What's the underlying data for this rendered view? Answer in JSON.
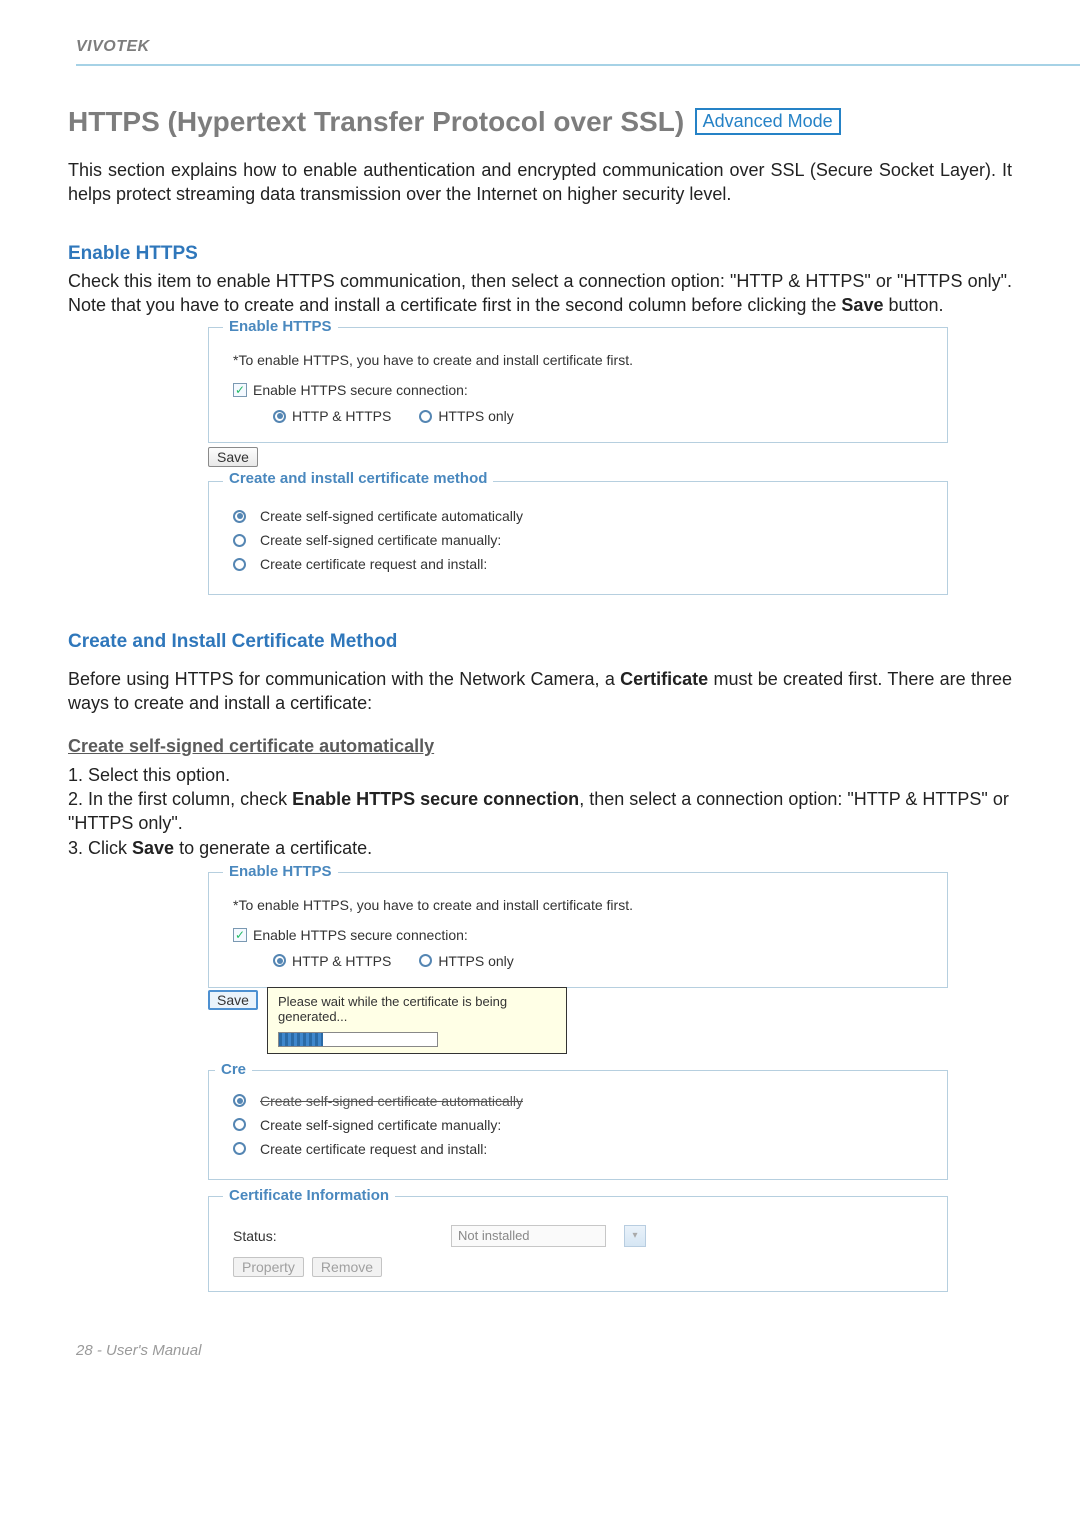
{
  "header": {
    "brand": "VIVOTEK"
  },
  "title": {
    "main": "HTTPS (Hypertext Transfer Protocol over SSL)",
    "badge": "Advanced Mode"
  },
  "intro": "This section explains how to enable authentication and encrypted communication over SSL (Secure Socket Layer). It helps protect streaming data transmission over the Internet on higher security level.",
  "sections": {
    "enable": {
      "heading": "Enable HTTPS",
      "body_1": "Check this item to enable HTTPS communication, then select a connection option: \"HTTP & HTTPS\" or \"HTTPS only\". Note that you have to create and install a certificate first in the second column before clicking the ",
      "body_bold": "Save",
      "body_2": " button."
    },
    "cert": {
      "heading": "Create and Install Certificate Method",
      "body_1": "Before using HTTPS for communication with the Network Camera, a ",
      "body_bold": "Certificate",
      "body_2": " must be created first. There are three ways to create and install a certificate:"
    },
    "auto": {
      "subheading": "Create self-signed certificate automatically",
      "step1": "Select this option.",
      "step2_a": "In the first column, check ",
      "step2_bold": "Enable HTTPS secure connection",
      "step2_b": ", then select a connection option: \"HTTP & HTTPS\" or \"HTTPS only\".",
      "step3_a": "Click ",
      "step3_bold": "Save",
      "step3_b": " to generate a certificate."
    }
  },
  "panel1": {
    "legend": "Enable HTTPS",
    "hint": "*To enable HTTPS, you have to create and install certificate first.",
    "chk_label": "Enable HTTPS secure connection:",
    "chk_checked": true,
    "radio1": "HTTP & HTTPS",
    "radio2": "HTTPS only",
    "radio_selected": 1,
    "save": "Save",
    "cert_legend": "Create and install certificate method",
    "opts": {
      "a": "Create self-signed certificate automatically",
      "b": "Create self-signed certificate manually:",
      "c": "Create certificate request and install:"
    },
    "cert_selected": 0
  },
  "panel2": {
    "legend": "Enable HTTPS",
    "hint": "*To enable HTTPS, you have to create and install certificate first.",
    "chk_label": "Enable HTTPS secure connection:",
    "radio1": "HTTP & HTTPS",
    "radio2": "HTTPS only",
    "save": "Save",
    "tooltip": "Please wait while the certificate is being generated...",
    "cert_legend_partial": "Cre",
    "opt_a_struck": "Create self-signed certificate automatically",
    "opt_b": "Create self-signed certificate manually:",
    "opt_c": "Create certificate request and install:",
    "info_legend": "Certificate Information",
    "status_label": "Status:",
    "status_value": "Not installed",
    "property": "Property",
    "remove": "Remove"
  },
  "footer": {
    "page": "28 - User's Manual"
  }
}
